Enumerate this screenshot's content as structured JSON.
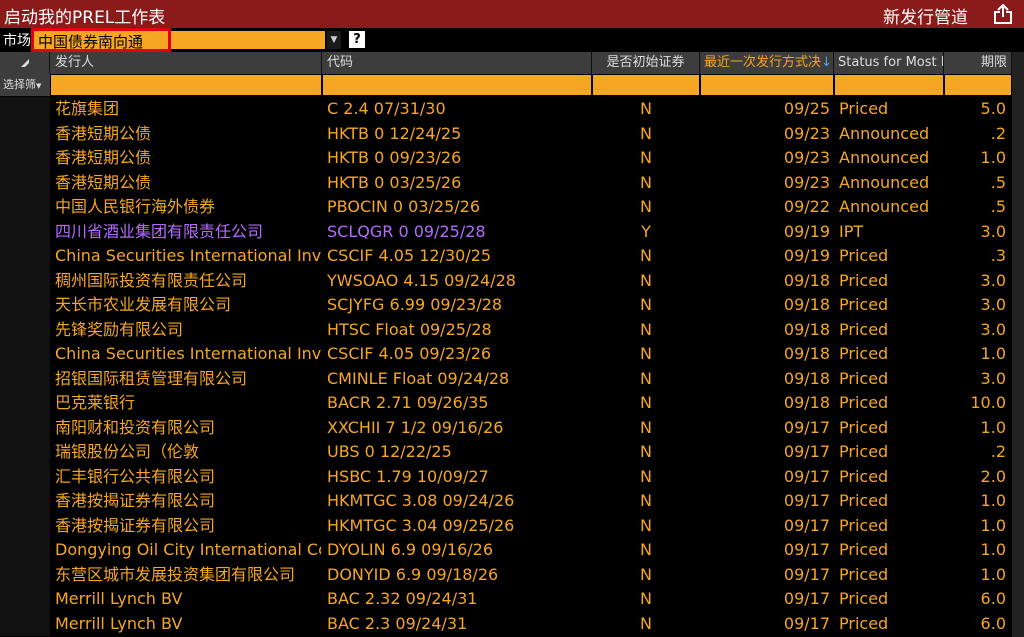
{
  "app": {
    "title": "启动我的PREL工作表",
    "right_title": "新发行管道",
    "share_icon": "share-export-icon"
  },
  "market": {
    "label": "市场",
    "selected": "中国债券南向通",
    "help": "?"
  },
  "table": {
    "headers": {
      "gutter": "",
      "issuer": "发行人",
      "code": "代码",
      "initial": "是否初始证券",
      "last_issue": "最近一次发行方式决",
      "status": "Status for Most R",
      "term": "期限"
    },
    "filter_label": "选择筛",
    "rows": [
      {
        "issuer": "花旗集团",
        "code": "C 2.4 07/31/30",
        "initial": "N",
        "date": "09/25",
        "status": "Priced",
        "term": "5.0"
      },
      {
        "issuer": "香港短期公债",
        "code": "HKTB 0 12/24/25",
        "initial": "N",
        "date": "09/23",
        "status": "Announced",
        "term": ".2"
      },
      {
        "issuer": "香港短期公债",
        "code": "HKTB 0 09/23/26",
        "initial": "N",
        "date": "09/23",
        "status": "Announced",
        "term": "1.0"
      },
      {
        "issuer": "香港短期公债",
        "code": "HKTB 0 03/25/26",
        "initial": "N",
        "date": "09/23",
        "status": "Announced",
        "term": ".5"
      },
      {
        "issuer": "中国人民银行海外债券",
        "code": "PBOCIN 0 03/25/26",
        "initial": "N",
        "date": "09/22",
        "status": "Announced",
        "term": ".5"
      },
      {
        "issuer": "四川省酒业集团有限责任公司",
        "code": "SCLQGR 0 09/25/28",
        "initial": "Y",
        "date": "09/19",
        "status": "IPT",
        "term": "3.0"
      },
      {
        "issuer": "China Securities International Inv",
        "code": "CSCIF 4.05 12/30/25",
        "initial": "N",
        "date": "09/19",
        "status": "Priced",
        "term": ".3"
      },
      {
        "issuer": "稠州国际投资有限责任公司",
        "code": "YWSOAO 4.15 09/24/28",
        "initial": "N",
        "date": "09/18",
        "status": "Priced",
        "term": "3.0"
      },
      {
        "issuer": "天长市农业发展有限公司",
        "code": "SCJYFG 6.99 09/23/28",
        "initial": "N",
        "date": "09/18",
        "status": "Priced",
        "term": "3.0"
      },
      {
        "issuer": "先锋奖励有限公司",
        "code": "HTSC Float 09/25/28",
        "initial": "N",
        "date": "09/18",
        "status": "Priced",
        "term": "3.0"
      },
      {
        "issuer": "China Securities International Inv",
        "code": "CSCIF 4.05 09/23/26",
        "initial": "N",
        "date": "09/18",
        "status": "Priced",
        "term": "1.0"
      },
      {
        "issuer": "招银国际租赁管理有限公司",
        "code": "CMINLE Float 09/24/28",
        "initial": "N",
        "date": "09/18",
        "status": "Priced",
        "term": "3.0"
      },
      {
        "issuer": "巴克莱银行",
        "code": "BACR 2.71 09/26/35",
        "initial": "N",
        "date": "09/18",
        "status": "Priced",
        "term": "10.0"
      },
      {
        "issuer": "南阳财和投资有限公司",
        "code": "XXCHII 7 1/2 09/16/26",
        "initial": "N",
        "date": "09/17",
        "status": "Priced",
        "term": "1.0"
      },
      {
        "issuer": "瑞银股份公司（伦敦",
        "code": "UBS 0 12/22/25",
        "initial": "N",
        "date": "09/17",
        "status": "Priced",
        "term": ".2"
      },
      {
        "issuer": "汇丰银行公共有限公司",
        "code": "HSBC 1.79 10/09/27",
        "initial": "N",
        "date": "09/17",
        "status": "Priced",
        "term": "2.0"
      },
      {
        "issuer": "香港按揭证券有限公司",
        "code": "HKMTGC 3.08 09/24/26",
        "initial": "N",
        "date": "09/17",
        "status": "Priced",
        "term": "1.0"
      },
      {
        "issuer": "香港按揭证券有限公司",
        "code": "HKMTGC 3.04 09/25/26",
        "initial": "N",
        "date": "09/17",
        "status": "Priced",
        "term": "1.0"
      },
      {
        "issuer": "Dongying Oil City International Co",
        "code": "DYOLIN 6.9 09/16/26",
        "initial": "N",
        "date": "09/17",
        "status": "Priced",
        "term": "1.0"
      },
      {
        "issuer": "东营区城市发展投资集团有限公司",
        "code": "DONYID 6.9 09/18/26",
        "initial": "N",
        "date": "09/17",
        "status": "Priced",
        "term": "1.0"
      },
      {
        "issuer": "Merrill Lynch BV",
        "code": "BAC 2.32 09/24/31",
        "initial": "N",
        "date": "09/17",
        "status": "Priced",
        "term": "6.0"
      },
      {
        "issuer": "Merrill Lynch BV",
        "code": "BAC 2.3 09/24/31",
        "initial": "N",
        "date": "09/17",
        "status": "Priced",
        "term": "6.0"
      }
    ]
  },
  "colors": {
    "accent": "#f5a623",
    "titlebar": "#8b1a1a",
    "ipt_text": "#b36bff",
    "highlight_border": "#e3000f"
  }
}
